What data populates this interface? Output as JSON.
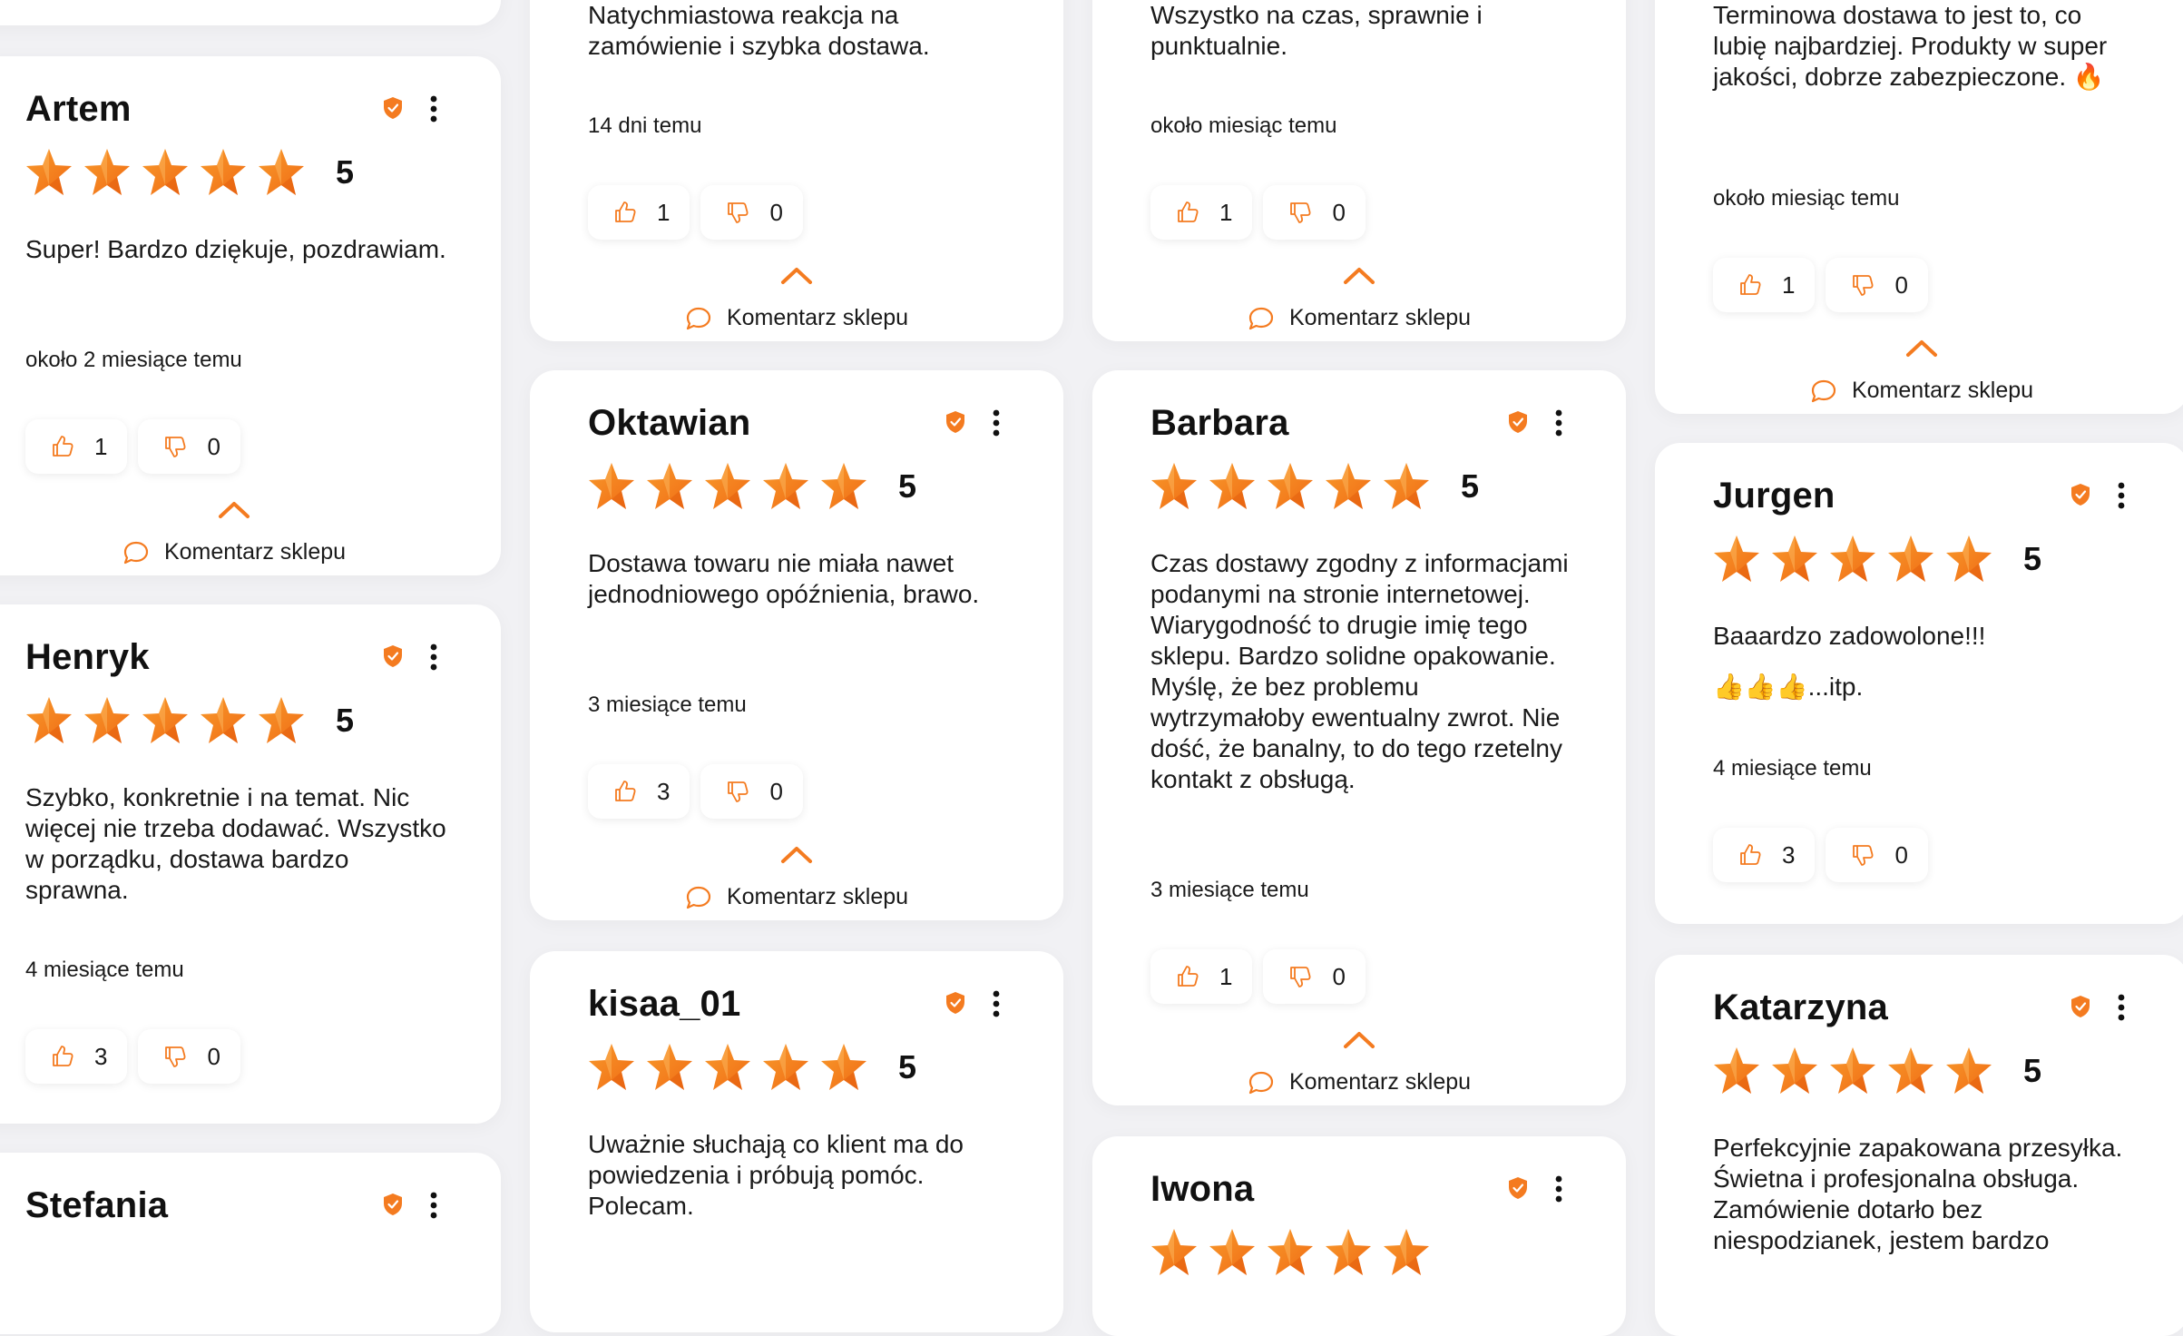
{
  "colors": {
    "accent": "#f47b20",
    "background": "#f1f1f4",
    "card": "#ffffff"
  },
  "icons": {
    "verified": "verified-shield-icon",
    "menu": "more-vertical-icon",
    "star": "star-icon",
    "like": "thumbs-up-icon",
    "dislike": "thumbs-down-icon",
    "toggle": "chevron-up-icon",
    "comment": "comment-bubble-icon"
  },
  "reply_label": "Komentarz sklepu",
  "reviews": [
    {
      "id": "c1-top",
      "author": "",
      "rating": "",
      "text": "",
      "time": "",
      "likes": "",
      "dislikes": "",
      "stars": 0
    },
    {
      "id": "artem",
      "author": "Artem",
      "rating": "5",
      "stars": 5,
      "text": "Super! Bardzo dziękuje, pozdrawiam.",
      "time": "około 2 miesiące temu",
      "likes": "1",
      "dislikes": "0"
    },
    {
      "id": "henryk",
      "author": "Henryk",
      "rating": "5",
      "stars": 5,
      "text": "Szybko, konkretnie i na temat. Nic więcej nie trzeba dodawać. Wszystko w porządku, dostawa bardzo sprawna.",
      "time": "4 miesiące temu",
      "likes": "3",
      "dislikes": "0"
    },
    {
      "id": "stefania",
      "author": "Stefania",
      "rating": "",
      "stars": 0,
      "text": "",
      "time": "",
      "likes": "",
      "dislikes": ""
    },
    {
      "id": "c2-top",
      "author": "",
      "rating": "",
      "stars": 0,
      "text": "Natychmiastowa reakcja na zamówienie i szybka dostawa.",
      "time": "14 dni temu",
      "likes": "1",
      "dislikes": "0"
    },
    {
      "id": "oktawian",
      "author": "Oktawian",
      "rating": "5",
      "stars": 5,
      "text": "Dostawa towaru nie miała nawet jednodniowego opóźnienia, brawo.",
      "time": "3 miesiące temu",
      "likes": "3",
      "dislikes": "0"
    },
    {
      "id": "kisaa",
      "author": "kisaa_01",
      "rating": "5",
      "stars": 5,
      "text": "Uważnie słuchają co klient ma do powiedzenia i próbują pomóc. Polecam.",
      "time": "",
      "likes": "",
      "dislikes": ""
    },
    {
      "id": "c3-top",
      "author": "",
      "rating": "",
      "stars": 0,
      "text": "Wszystko na czas, sprawnie i punktualnie.",
      "time": "około miesiąc temu",
      "likes": "1",
      "dislikes": "0"
    },
    {
      "id": "barbara",
      "author": "Barbara",
      "rating": "5",
      "stars": 5,
      "text": "Czas dostawy zgodny z informacjami podanymi na stronie internetowej. Wiarygodność to drugie imię tego sklepu. Bardzo solidne opakowanie. Myślę, że bez problemu wytrzymałoby ewentualny zwrot. Nie dość, że banalny, to do tego rzetelny kontakt z obsługą.",
      "time": "3 miesiące temu",
      "likes": "1",
      "dislikes": "0"
    },
    {
      "id": "iwona",
      "author": "Iwona",
      "rating": "",
      "stars": 5,
      "text": "",
      "time": "",
      "likes": "",
      "dislikes": ""
    },
    {
      "id": "c4-top",
      "author": "",
      "rating": "",
      "stars": 0,
      "text": "Terminowa dostawa to jest to, co lubię najbardziej. Produkty w super jakości, dobrze zabezpieczone. 🔥",
      "time": "około miesiąc temu",
      "likes": "1",
      "dislikes": "0"
    },
    {
      "id": "jurgen",
      "author": "Jurgen",
      "rating": "5",
      "stars": 5,
      "text": "Baaardzo zadowolone!!!",
      "text2": "👍👍👍...itp.",
      "time": "4 miesiące temu",
      "likes": "3",
      "dislikes": "0"
    },
    {
      "id": "katarzyna",
      "author": "Katarzyna",
      "rating": "5",
      "stars": 5,
      "text": "Perfekcyjnie zapakowana przesyłka. Świetna i profesjonalna obsługa. Zamówienie dotarło bez niespodzianek, jestem bardzo",
      "time": "",
      "likes": "",
      "dislikes": ""
    }
  ]
}
